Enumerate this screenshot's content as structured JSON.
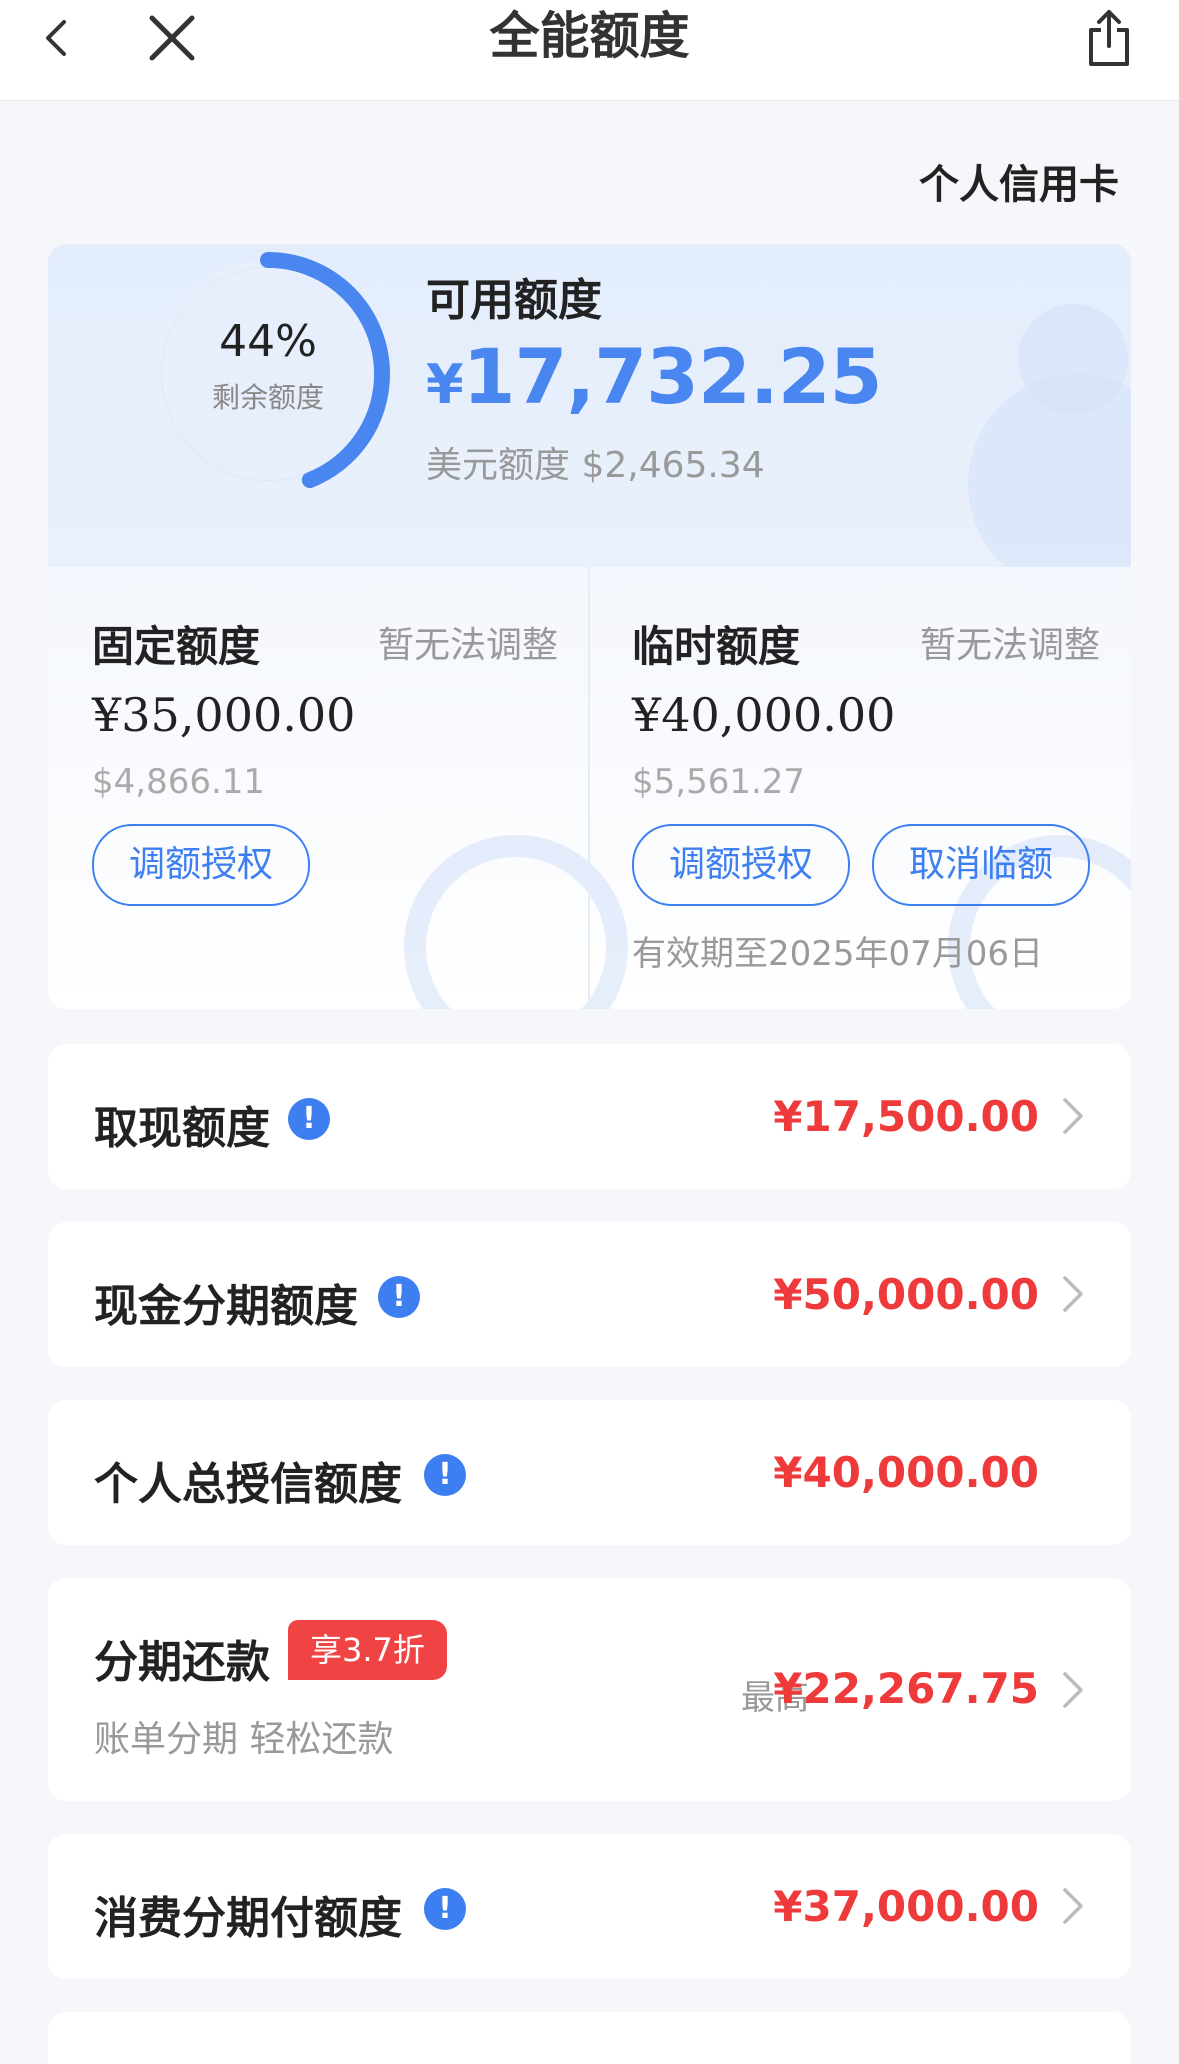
{
  "nav": {
    "title": "全能额度"
  },
  "card_type": "个人信用卡",
  "summary": {
    "percent": "44%",
    "percent_value": 0.44,
    "percent_label": "剩余额度",
    "available_label": "可用额度",
    "currency_symbol": "¥",
    "available_amount": "17,732.25",
    "usd_label": "美元额度",
    "usd_amount": "$2,465.34"
  },
  "fixed": {
    "title": "固定额度",
    "note": "暂无法调整",
    "amount": "¥35,000.00",
    "usd": "$4,866.11",
    "btn_adjust": "调额授权"
  },
  "temp": {
    "title": "临时额度",
    "note": "暂无法调整",
    "amount": "¥40,000.00",
    "usd": "$5,561.27",
    "btn_adjust": "调额授权",
    "btn_cancel": "取消临额",
    "expire": "有效期至2025年07月06日"
  },
  "rows": [
    {
      "label": "取现额度",
      "value": "¥17,500.00"
    },
    {
      "label": "现金分期额度",
      "value": "¥50,000.00"
    },
    {
      "label": "个人总授信额度",
      "value": "¥40,000.00"
    },
    {
      "label": "分期还款",
      "badge": "享3.7折",
      "sub": "账单分期 轻松还款",
      "prefix": "最高",
      "value": "¥22,267.75"
    },
    {
      "label": "消费分期付额度",
      "value": "¥37,000.00"
    }
  ],
  "info_glyph": "!",
  "colors": {
    "accent": "#4a86f0",
    "value_red": "#ee3a3a",
    "promo_bg": "#f04444"
  }
}
